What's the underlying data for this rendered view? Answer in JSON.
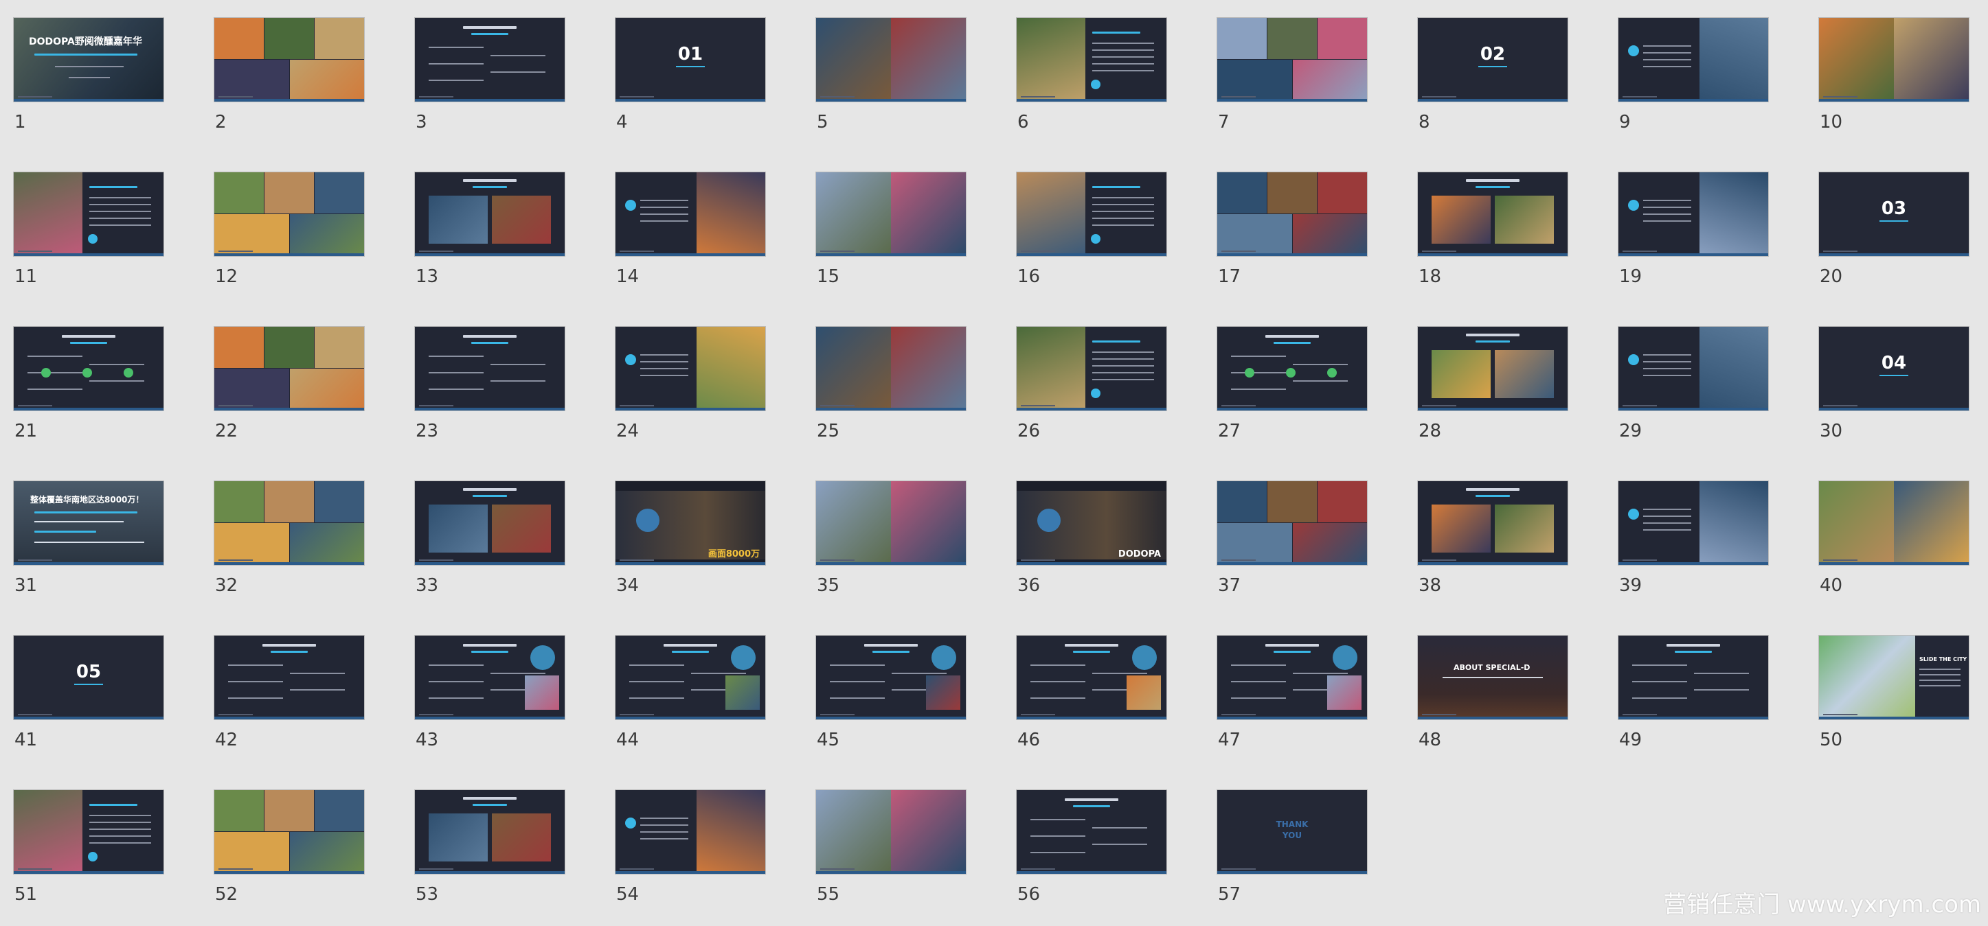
{
  "slides": [
    {
      "num": "1",
      "text": "DODOPA野阅微醺嘉年华"
    },
    {
      "num": "2"
    },
    {
      "num": "3"
    },
    {
      "num": "4",
      "text": "01"
    },
    {
      "num": "5"
    },
    {
      "num": "6"
    },
    {
      "num": "7"
    },
    {
      "num": "8",
      "text": "02"
    },
    {
      "num": "9"
    },
    {
      "num": "10"
    },
    {
      "num": "11"
    },
    {
      "num": "12"
    },
    {
      "num": "13"
    },
    {
      "num": "14"
    },
    {
      "num": "15"
    },
    {
      "num": "16"
    },
    {
      "num": "17"
    },
    {
      "num": "18"
    },
    {
      "num": "19"
    },
    {
      "num": "20",
      "text": "03"
    },
    {
      "num": "21"
    },
    {
      "num": "22"
    },
    {
      "num": "23"
    },
    {
      "num": "24"
    },
    {
      "num": "25"
    },
    {
      "num": "26"
    },
    {
      "num": "27"
    },
    {
      "num": "28"
    },
    {
      "num": "29"
    },
    {
      "num": "30",
      "text": "04"
    },
    {
      "num": "31",
      "text": "整体覆盖华南地区达8000万！"
    },
    {
      "num": "32"
    },
    {
      "num": "33"
    },
    {
      "num": "34",
      "text": "画面8000万"
    },
    {
      "num": "35"
    },
    {
      "num": "36",
      "text": "DODOPA"
    },
    {
      "num": "37"
    },
    {
      "num": "38"
    },
    {
      "num": "39"
    },
    {
      "num": "40"
    },
    {
      "num": "41",
      "text": "05"
    },
    {
      "num": "42"
    },
    {
      "num": "43"
    },
    {
      "num": "44"
    },
    {
      "num": "45"
    },
    {
      "num": "46"
    },
    {
      "num": "47"
    },
    {
      "num": "48",
      "text": "ABOUT SPECIAL-D"
    },
    {
      "num": "49"
    },
    {
      "num": "50",
      "text": "SLIDE THE CITY"
    },
    {
      "num": "51"
    },
    {
      "num": "52"
    },
    {
      "num": "53"
    },
    {
      "num": "54"
    },
    {
      "num": "55"
    },
    {
      "num": "56"
    },
    {
      "num": "57",
      "text": "THANK YOU"
    }
  ],
  "watermark": "营销任意门 www.yxrym.com",
  "colors": {
    "background": "#e6e6e6",
    "slide": "#222634",
    "accent": "#3ab7e6"
  }
}
